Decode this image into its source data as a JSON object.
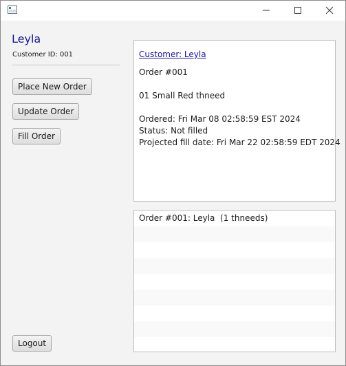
{
  "window": {
    "controls": [
      "minimize-icon",
      "maximize-icon",
      "close-icon"
    ]
  },
  "sidebar": {
    "customer_name": "Leyla",
    "customer_id": "Customer ID: 001",
    "buttons": {
      "place_new_order": "Place New Order",
      "update_order": "Update Order",
      "fill_order": "Fill Order",
      "logout": "Logout"
    }
  },
  "details": {
    "customer_link": "Customer: Leyla ",
    "order_number": "Order #001",
    "item": "01 Small Red thneed",
    "ordered": "Ordered: Fri Mar 08 02:58:59 EST 2024",
    "status": "Status: Not filled",
    "projected": "Projected fill date: Fri Mar 22 02:58:59 EDT 2024"
  },
  "orders_list": {
    "items": [
      "Order #001: Leyla  (1 thneeds)",
      "",
      "",
      "",
      "",
      "",
      "",
      "",
      ""
    ]
  }
}
